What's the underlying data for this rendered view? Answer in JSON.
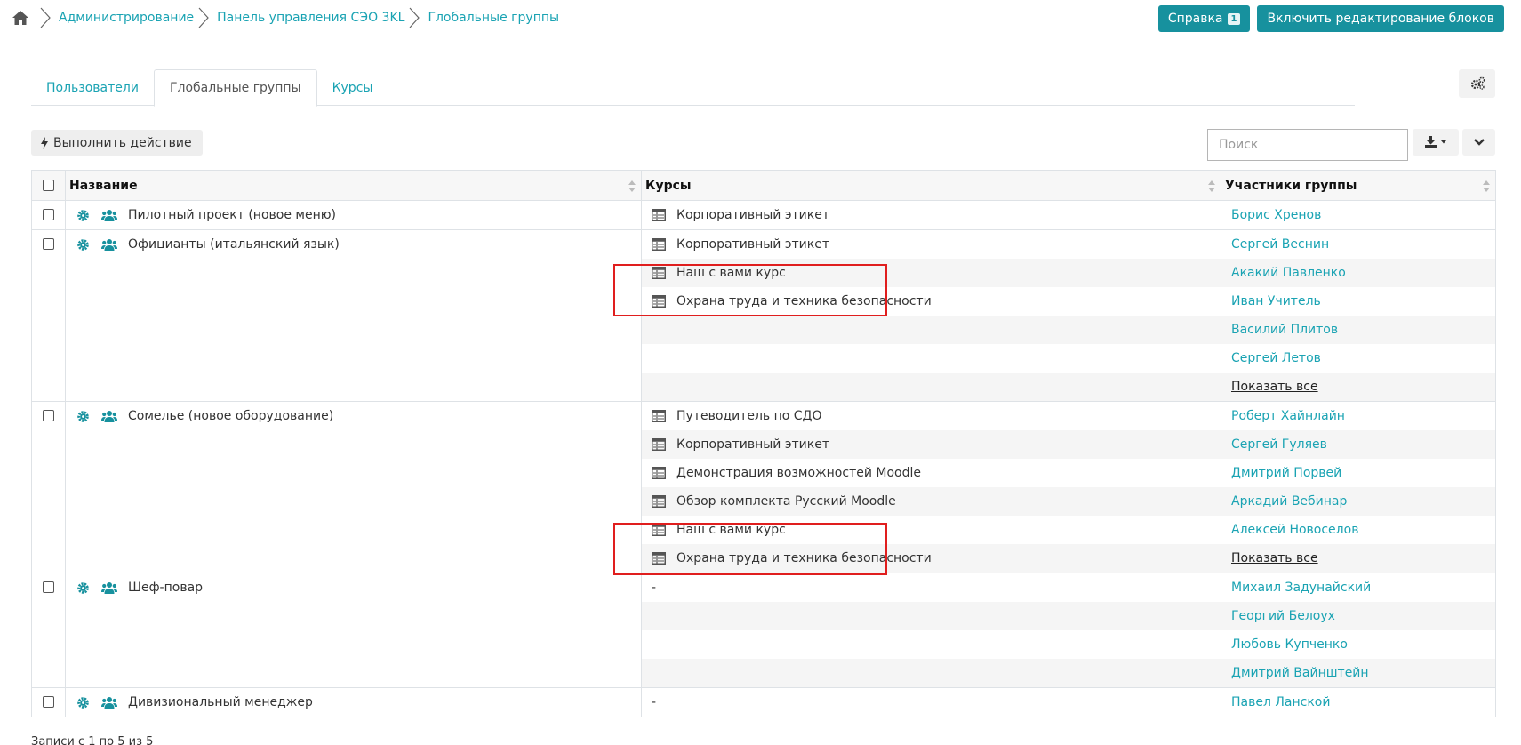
{
  "breadcrumb": {
    "items": [
      "Администрирование",
      "Панель управления СЭО 3KL",
      "Глобальные группы"
    ]
  },
  "header": {
    "help_label": "Справка",
    "help_badge": "1",
    "edit_blocks_label": "Включить редактирование блоков"
  },
  "tabs": [
    {
      "label": "Пользователи",
      "active": false
    },
    {
      "label": "Глобальные группы",
      "active": true
    },
    {
      "label": "Курсы",
      "active": false
    }
  ],
  "toolbar": {
    "action_label": "Выполнить действие",
    "search_placeholder": "Поиск"
  },
  "table": {
    "headers": [
      "Название",
      "Курсы",
      "Участники группы"
    ],
    "groups": [
      {
        "name": "Пилотный проект (новое меню)",
        "courses": [
          "Корпоративный этикет"
        ],
        "members": [
          "Борис Хренов"
        ]
      },
      {
        "name": "Официанты (итальянский язык)",
        "courses": [
          "Корпоративный этикет",
          "Наш с вами курс",
          "Охрана труда и техника безопасности"
        ],
        "members": [
          "Сергей Веснин",
          "Акакий Павленко",
          "Иван Учитель",
          "Василий Плитов",
          "Сергей Летов",
          "Показать все"
        ]
      },
      {
        "name": "Сомелье (новое оборудование)",
        "courses": [
          "Путеводитель по СДО",
          "Корпоративный этикет",
          "Демонстрация возможностей Moodle",
          "Обзор комплекта Русский Moodle",
          "Наш с вами курс",
          "Охрана труда и техника безопасности"
        ],
        "members": [
          "Роберт Хайнлайн",
          "Сергей Гуляев",
          "Дмитрий Порвей",
          "Аркадий Вебинар",
          "Алексей Новоселов",
          "Показать все"
        ]
      },
      {
        "name": "Шеф-повар",
        "courses": [
          "-"
        ],
        "members": [
          "Михаил Задунайский",
          "Георгий Белоух",
          "Любовь Купченко",
          "Дмитрий Вайнштейн"
        ]
      },
      {
        "name": "Дивизиональный менеджер",
        "courses": [
          "-"
        ],
        "members": [
          "Павел Ланской"
        ]
      }
    ]
  },
  "footer": {
    "records_text": "Записи с 1 по 5 из 5"
  },
  "colors": {
    "accent": "#17919e",
    "link": "#1aa3b3",
    "highlight": "#e01e1e"
  }
}
